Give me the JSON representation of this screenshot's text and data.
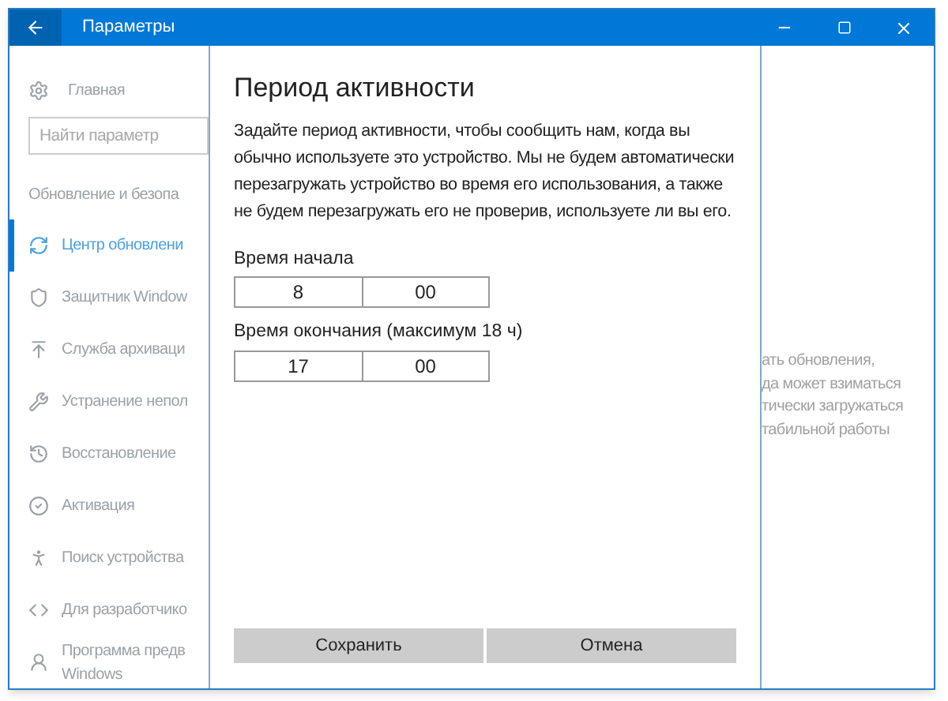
{
  "window": {
    "title": "Параметры"
  },
  "sidebar": {
    "home": "Главная",
    "search": {
      "placeholder": "Найти параметр"
    },
    "section": "Обновление и безопа",
    "items": [
      {
        "kind": "update",
        "label": "Центр обновлени",
        "selected": true
      },
      {
        "kind": "shield",
        "label": "Защитник Window",
        "selected": false
      },
      {
        "kind": "backup",
        "label": "Служба архиваци",
        "selected": false
      },
      {
        "kind": "wrench",
        "label": "Устранение непол",
        "selected": false
      },
      {
        "kind": "history",
        "label": "Восстановление",
        "selected": false
      },
      {
        "kind": "check",
        "label": "Активация",
        "selected": false
      },
      {
        "kind": "person",
        "label": "Поиск устройства",
        "selected": false
      },
      {
        "kind": "dev",
        "label": "Для разработчико",
        "selected": false
      },
      {
        "kind": "insider",
        "label": "Программа предв\nWindows",
        "selected": false
      }
    ]
  },
  "dialog": {
    "title": "Период активности",
    "text": "Задайте период активности, чтобы сообщить нам, когда вы обычно используете это устройство. Мы не будем автоматически перезагружать устройство во время его использования, а также не будем перезагружать его не проверив, используете ли вы его.",
    "start": {
      "label": "Время начала",
      "hour": "8",
      "minute": "00"
    },
    "end": {
      "label": "Время окончания (максимум 18 ч)",
      "hour": "17",
      "minute": "00"
    },
    "buttons": [
      "Сохранить",
      "Отмена"
    ]
  },
  "background_text": [
    "ать обновления,",
    "да может взиматься",
    "тически загружаться",
    "табильной работы"
  ]
}
